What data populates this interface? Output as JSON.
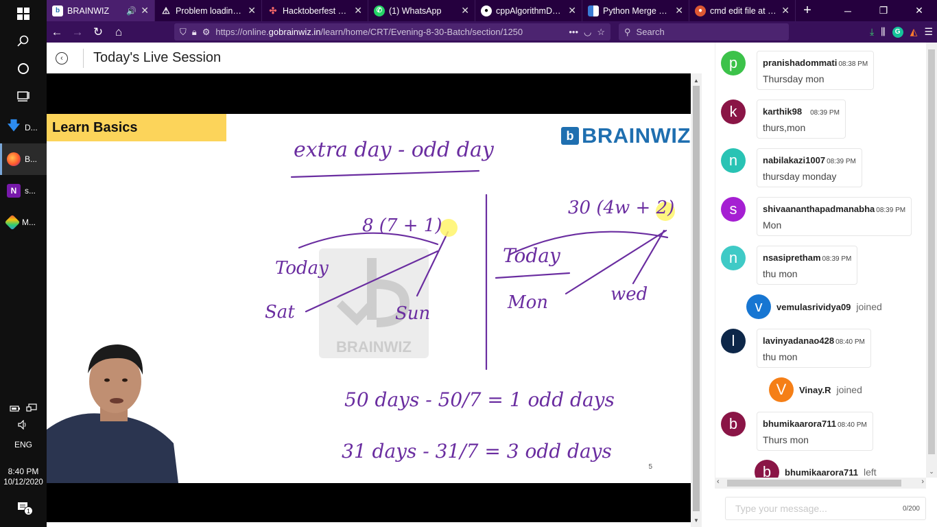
{
  "taskbar": {
    "apps": [
      {
        "label": "D...",
        "icon": "download-icon"
      },
      {
        "label": "B...",
        "icon": "firefox-icon"
      },
      {
        "label": "s...",
        "icon": "onenote-icon"
      },
      {
        "label": "M...",
        "icon": "app-icon"
      }
    ],
    "lang": "ENG",
    "time": "8:40 PM",
    "date": "10/12/2020",
    "notif_count": "1"
  },
  "tabs": [
    {
      "label": "BRAINWIZ",
      "icon": "brainwiz-icon",
      "active": true
    },
    {
      "label": "Problem loading page",
      "icon": "warning-icon"
    },
    {
      "label": "Hacktoberfest presents",
      "icon": "hacktoberfest-icon"
    },
    {
      "label": "(1) WhatsApp",
      "icon": "whatsapp-icon"
    },
    {
      "label": "cppAlgorithmDesign",
      "icon": "github-icon"
    },
    {
      "label": "Python Merge Sort",
      "icon": "grid-icon"
    },
    {
      "label": "cmd edit file at Duck",
      "icon": "duckduckgo-icon"
    }
  ],
  "urlbar": {
    "prefix": "https://online.",
    "domain": "gobrainwiz.in",
    "path": "/learn/home/CRT/Evening-8-30-Batch/section/1250"
  },
  "search": {
    "placeholder": "Search"
  },
  "session": {
    "title": "Today's Live Session"
  },
  "slide": {
    "banner": "Learn Basics",
    "brand_logo": "b",
    "brand_name": "BRAINWIZ",
    "watermark": "BRAINWIZ",
    "page_number": "5",
    "notes": {
      "title": "extra day - odd day",
      "left_eq": "8 (7 + 1)",
      "left_today": "Today",
      "left_from": "Sat",
      "left_to": "Sun",
      "right_eq": "30 (4w + 2)",
      "right_today": "Today",
      "right_from": "Mon",
      "right_to": "wed",
      "line1": "50 days - 50/7 = 1 odd days",
      "line2": "31 days - 31/7 = 3 odd days"
    }
  },
  "chat": {
    "messages": [
      {
        "type": "msg",
        "initial": "p",
        "color": "#3cc24a",
        "user": "pranishadommati",
        "time": "08:38 PM",
        "text": "Thursday mon"
      },
      {
        "type": "msg",
        "initial": "k",
        "color": "#8a1546",
        "user": "karthik98",
        "time": "08:39 PM",
        "text": "thurs,mon"
      },
      {
        "type": "msg",
        "initial": "n",
        "color": "#29c3b4",
        "user": "nabilakazi1007",
        "time": "08:39 PM",
        "text": "thursday monday"
      },
      {
        "type": "msg",
        "initial": "s",
        "color": "#a51fd2",
        "user": "shivaananthapadmanabha",
        "time": "08:39 PM",
        "text": "Mon"
      },
      {
        "type": "msg",
        "initial": "n",
        "color": "#3fcac6",
        "user": "nsasipretham",
        "time": "08:39 PM",
        "text": "thu mon"
      },
      {
        "type": "event",
        "initial": "v",
        "color": "#1776d2",
        "user": "vemulasrividya09",
        "action": "joined"
      },
      {
        "type": "msg",
        "initial": "l",
        "color": "#0d2749",
        "user": "lavinyadanao428",
        "time": "08:40 PM",
        "text": "thu mon"
      },
      {
        "type": "event",
        "initial": "V",
        "color": "#f57f17",
        "user": "Vinay.R",
        "action": "joined"
      },
      {
        "type": "msg",
        "initial": "b",
        "color": "#8a1546",
        "user": "bhumikaarora711",
        "time": "08:40 PM",
        "text": "Thurs mon"
      },
      {
        "type": "event",
        "initial": "b",
        "color": "#8a1546",
        "user": "bhumikaarora711",
        "action": "left"
      }
    ],
    "input_placeholder": "Type your message...",
    "char_count": "0/200"
  }
}
